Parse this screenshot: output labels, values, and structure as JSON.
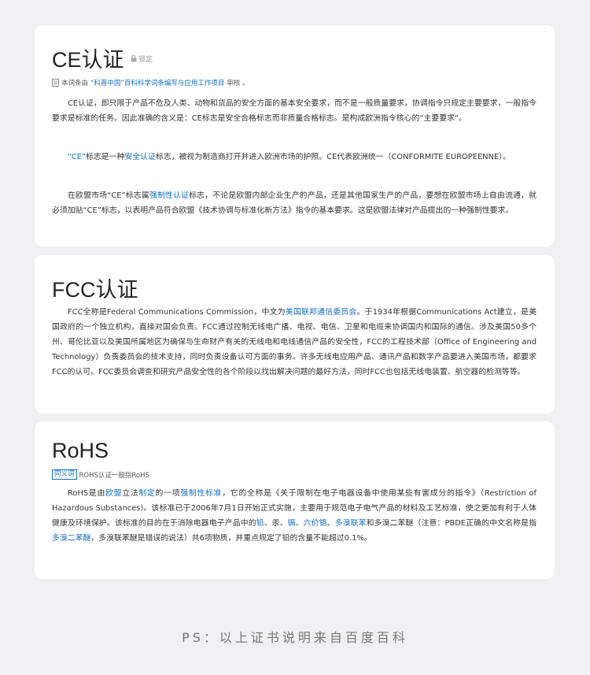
{
  "ce": {
    "title": "CE认证",
    "lock_label": "锁定",
    "review_note_prefix": "本词条由",
    "review_note_link": "“科普中国”百科科学词条编写与应用工作项目",
    "review_note_suffix": "审核 。",
    "p1": "CE认证，即只限于产品不危及人类、动物和货品的安全方面的基本安全要求，而不是一般质量要求，协调指令只规定主要要求，一般指令要求是标准的任务。因此准确的含义是：CE标志是安全合格标志而非质量合格标志。是构成欧洲指令核心的“主要要求”。",
    "p2_link1": "“CE”",
    "p2_a": "标志是一种",
    "p2_link2": "安全认证",
    "p2_b": "标志，被视为制造商打开并进入欧洲市场的护照。CE代表欧洲统一（CONFORMITE EUROPEENNE）。",
    "p3_a": "在欧盟市场“CE”标志属",
    "p3_link": "强制性认证",
    "p3_b": "标志，不论是欧盟内部企业生产的产品，还是其他国家生产的产品，要想在欧盟市场上自由流通，就必须加贴“CE”标志，以表明产品符合欧盟《技术协调与标准化新方法》指令的基本要求。这是欧盟法律对产品提出的一种强制性要求。"
  },
  "fcc": {
    "title": "FCC认证",
    "p_a": "FCC全称是Federal Communications Commission，中文为",
    "p_link": "美国联邦通信委员会",
    "p_b": "。于1934年根据Communications Act建立，是美国政府的一个独立机构，直接对国会负责。FCC通过控制无线电广播、电视、电信、卫星和电缆来协调国内和国际的通信。涉及美国50多个州、哥伦比亚以及美国所属地区为确保与生命财产有关的无线电和电线通信产品的安全性，FCC的工程技术部（Office of Engineering and Technology）负责委员会的技术支持，同时负责设备认可方面的事务。许多无线电应用产品、通讯产品和数字产品要进入美国市场，都要求FCC的认可。FCC委员会调查和研究产品安全性的各个阶段以找出解决问题的最好方法，同时FCC也包括无线电装置、航空器的检测等等。"
  },
  "rohs": {
    "title": "RoHS",
    "tag": "同义词",
    "tag_note": "ROHS认证一般指RoHS",
    "p_a": "RoHS是由",
    "link_eu": "欧盟",
    "p_b": "立法",
    "link_zhiding": "制定",
    "p_c": "的一项",
    "link_std": "强制性标准",
    "p_d": "，它的全称是《关于限制在电子电器设备中使用某些有害成分的指令》（Restriction of Hazardous Substances)。该标准已于2006年7月1日开始正式实施，主要用于规范电子电气产品的材料及工艺标准，使之更加有利于人体健康及环境保护。该标准的目的在于消除电器电子产品中的",
    "link_pb": "铅",
    "sep1": "、汞、",
    "link_cd": "镉",
    "sep2": "、",
    "link_cr": "六价铬",
    "sep3": "、",
    "link_pbb": "多溴联苯",
    "p_e": "和多溴二苯醚（注意：PBDE正确的中文名称是指",
    "link_pbde": "多溴二苯醚",
    "p_f": "，多溴联苯醚是错误的说法）共6项物质，并重点规定了铅的含量不能超过0.1%。"
  },
  "footer": {
    "ps": "PS：以上证书说明来自百度百科"
  },
  "colors": {
    "link": "#136ec2",
    "background": "#f0f0f2",
    "card": "#ffffff"
  }
}
